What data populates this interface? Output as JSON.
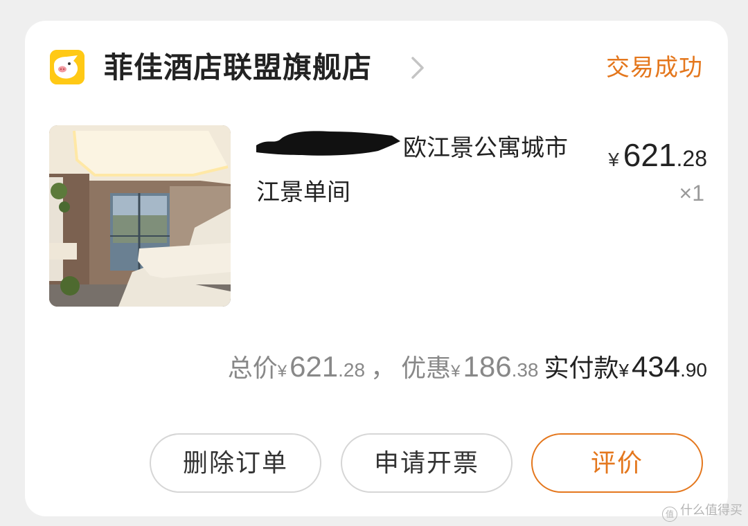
{
  "shop": {
    "name": "菲佳酒店联盟旗舰店",
    "logo_icon": "fliggy-pig-logo-icon",
    "chevron_icon": "chevron-right-icon",
    "status": "交易成功"
  },
  "product": {
    "title_visible": "欧江景公寓城市江景单间",
    "title_line1": "欧江景公寓城市",
    "title_line2": "江景单间",
    "image_icon": "hotel-room-photo",
    "currency": "¥",
    "price_int": "621",
    "price_dec": ".28",
    "quantity": "×1"
  },
  "summary": {
    "total_label": "总价",
    "total_int": "621",
    "total_dec": ".28",
    "separator": "，",
    "discount_label": "优惠",
    "discount_int": "186",
    "discount_dec": ".38",
    "paid_label": "实付款",
    "paid_int": "434",
    "paid_dec": ".90",
    "currency": "¥"
  },
  "actions": {
    "delete_label": "删除订单",
    "invoice_label": "申请开票",
    "review_label": "评价"
  },
  "watermark": {
    "badge": "值",
    "text": "什么值得买"
  },
  "colors": {
    "accent": "#e4771d",
    "logo_bg": "#ffc915",
    "card_bg": "#ffffff",
    "page_bg": "#efefef"
  }
}
